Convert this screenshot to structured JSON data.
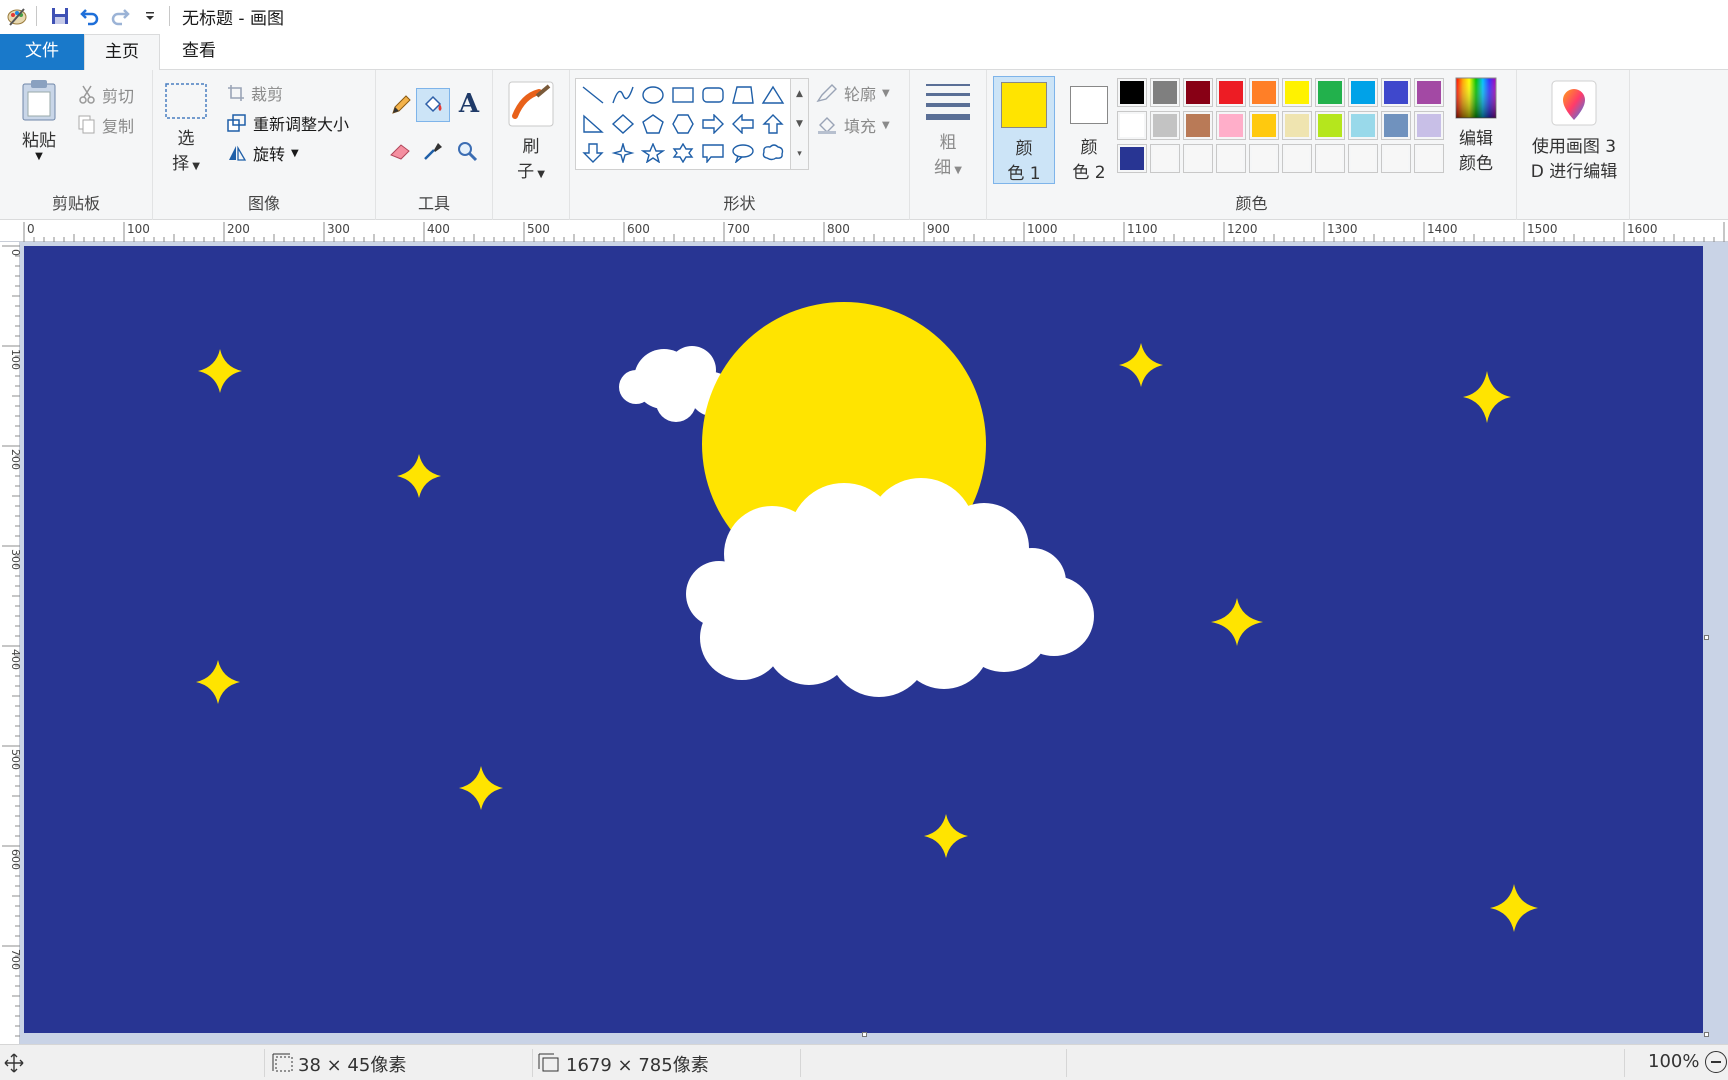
{
  "window": {
    "title": "无标题 - 画图"
  },
  "tabs": [
    {
      "label": "文件"
    },
    {
      "label": "主页"
    },
    {
      "label": "查看"
    }
  ],
  "ribbon": {
    "clipboard": {
      "paste": "粘贴",
      "cut": "剪切",
      "copy": "复制",
      "group": "剪贴板"
    },
    "image": {
      "select_line1": "选",
      "select_line2": "择",
      "crop": "裁剪",
      "resize": "重新调整大小",
      "rotate": "旋转",
      "group": "图像"
    },
    "tools": {
      "group": "工具"
    },
    "brushes": {
      "line1": "刷",
      "line2": "子"
    },
    "shapes": {
      "outline": "轮廓",
      "fill": "填充",
      "group": "形状"
    },
    "size": {
      "line1": "粗",
      "line2": "细"
    },
    "colors": {
      "color1_line1": "颜",
      "color1_line2": "色 1",
      "color2_line1": "颜",
      "color2_line2": "色 2",
      "edit_line1": "编辑",
      "edit_line2": "颜色",
      "group": "颜色",
      "color1_value": "#FFE400",
      "color2_value": "#FFFFFF",
      "palette_row1": [
        "#000000",
        "#7F7F7F",
        "#880015",
        "#ED1C24",
        "#FF7F27",
        "#FFF200",
        "#22B14C",
        "#00A2E8",
        "#3F48CC",
        "#A349A4"
      ],
      "palette_row2": [
        "#FFFFFF",
        "#C3C3C3",
        "#B97A57",
        "#FFAEC9",
        "#FFC90E",
        "#EFE4B0",
        "#B5E61D",
        "#99D9EA",
        "#7092BE",
        "#C8BFE7"
      ],
      "palette_row3": [
        "#283593",
        "#F7F7F7",
        "#F7F7F7",
        "#F7F7F7",
        "#F7F7F7",
        "#F7F7F7",
        "#F7F7F7",
        "#F7F7F7",
        "#F7F7F7",
        "#F7F7F7"
      ]
    },
    "paint3d": {
      "line1": "使用画图 3",
      "line2": "D 进行编辑"
    }
  },
  "rulers": {
    "horizontal": [
      "0",
      "100",
      "200",
      "300",
      "400",
      "500",
      "600",
      "700",
      "800",
      "900",
      "1000",
      "1100",
      "1200",
      "1300",
      "1400",
      "1500",
      "1600"
    ],
    "vertical": [
      "0",
      "100",
      "200",
      "300",
      "400",
      "500",
      "600",
      "700"
    ]
  },
  "canvas": {
    "background": "#283593",
    "sun_color": "#FFE400",
    "star_color": "#FFE400",
    "cloud_color": "#FFFFFF"
  },
  "status": {
    "selection_size": "38 × 45像素",
    "image_size": "1679 × 785像素",
    "zoom": "100%"
  }
}
